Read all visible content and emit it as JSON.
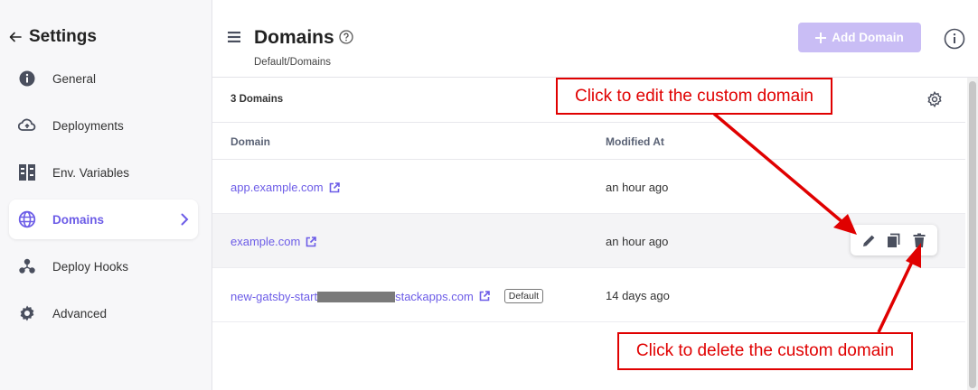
{
  "sidebar": {
    "title": "Settings",
    "items": [
      {
        "label": "General",
        "icon": "info-circle-icon"
      },
      {
        "label": "Deployments",
        "icon": "cloud-upload-icon"
      },
      {
        "label": "Env. Variables",
        "icon": "env-variables-icon"
      },
      {
        "label": "Domains",
        "icon": "globe-icon",
        "active": true
      },
      {
        "label": "Deploy Hooks",
        "icon": "deploy-hooks-icon"
      },
      {
        "label": "Advanced",
        "icon": "gear-icon"
      }
    ]
  },
  "header": {
    "title": "Domains",
    "breadcrumb": {
      "parent": "Default",
      "separator": "/",
      "current": "Domains"
    },
    "add_button": "Add Domain"
  },
  "table": {
    "count_label": "3 Domains",
    "columns": [
      "Domain",
      "Modified At"
    ],
    "rows": [
      {
        "domain": "app.example.com",
        "modified": "an hour ago"
      },
      {
        "domain": "example.com",
        "modified": "an hour ago"
      },
      {
        "domain_prefix": "new-gatsby-start",
        "domain_suffix": "stackapps.com",
        "modified": "14 days ago",
        "badge": "Default"
      }
    ]
  },
  "annotations": {
    "edit": "Click to edit the custom domain",
    "delete": "Click to delete the custom domain"
  },
  "colors": {
    "accent": "#6c5ce7",
    "annotation": "#e00000",
    "button_disabled": "#c9bdf5"
  }
}
